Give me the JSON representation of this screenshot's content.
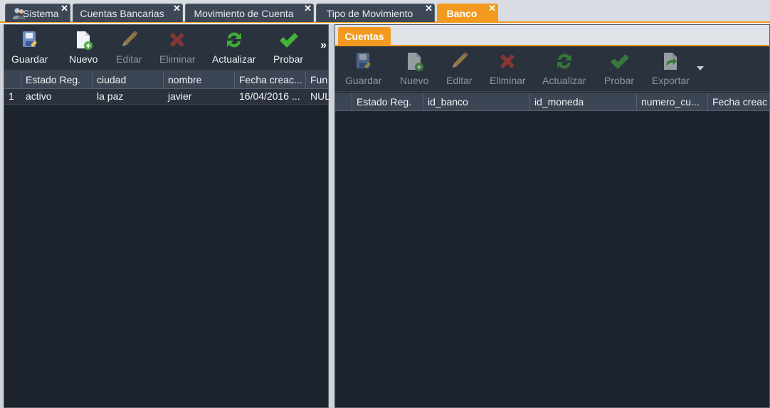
{
  "tabs": [
    {
      "label": "Sistema",
      "icon": "user-group-icon"
    },
    {
      "label": "Cuentas Bancarias"
    },
    {
      "label": "Movimiento de Cuenta"
    },
    {
      "label": "Tipo de Movimiento"
    },
    {
      "label": "Banco",
      "active": true
    }
  ],
  "close_glyph": "✕",
  "left": {
    "toolbar": {
      "guardar": "Guardar",
      "nuevo": "Nuevo",
      "editar": "Editar",
      "eliminar": "Eliminar",
      "actualizar": "Actualizar",
      "probar": "Probar",
      "more": "»"
    },
    "columns": [
      "Estado Reg.",
      "ciudad",
      "nombre",
      "Fecha creac...",
      "Fun"
    ],
    "rows": [
      {
        "num": "1",
        "cells": [
          "activo",
          "la paz",
          "javier",
          "16/04/2016 ...",
          "NUL"
        ]
      }
    ]
  },
  "right": {
    "subtab": "Cuentas",
    "toolbar": {
      "guardar": "Guardar",
      "nuevo": "Nuevo",
      "editar": "Editar",
      "eliminar": "Eliminar",
      "actualizar": "Actualizar",
      "probar": "Probar",
      "exportar": "Exportar"
    },
    "columns": [
      "Estado Reg.",
      "id_banco",
      "id_moneda",
      "numero_cu...",
      "Fecha creac"
    ]
  },
  "colors": {
    "accent": "#f29a1f",
    "panel_bg": "#1d232c",
    "toolbar_bg": "#2a323e"
  }
}
